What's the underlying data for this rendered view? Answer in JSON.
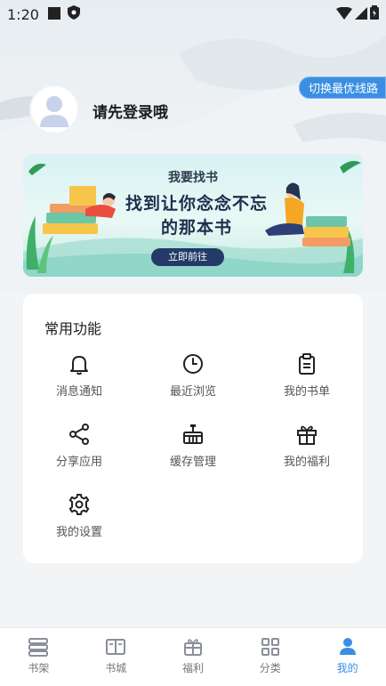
{
  "status_bar": {
    "time": "1:20"
  },
  "route_switch": {
    "label": "切换最优线路"
  },
  "profile": {
    "login_prompt": "请先登录哦"
  },
  "banner": {
    "heading": "我要找书",
    "slogan_line1": "找到让你念念不忘",
    "slogan_line2": "的那本书",
    "cta": "立即前往"
  },
  "functions": {
    "title": "常用功能",
    "items": [
      {
        "label": "消息通知",
        "icon": "bell-icon"
      },
      {
        "label": "最近浏览",
        "icon": "clock-icon"
      },
      {
        "label": "我的书单",
        "icon": "clipboard-icon"
      },
      {
        "label": "分享应用",
        "icon": "share-icon"
      },
      {
        "label": "缓存管理",
        "icon": "basket-icon"
      },
      {
        "label": "我的福利",
        "icon": "gift-icon"
      },
      {
        "label": "我的设置",
        "icon": "gear-icon"
      }
    ]
  },
  "nav": {
    "active": "我的",
    "accent_color": "#3b8fe3",
    "tabs": [
      {
        "label": "书架",
        "icon": "bookshelf-icon"
      },
      {
        "label": "书城",
        "icon": "open-book-icon"
      },
      {
        "label": "福利",
        "icon": "gift-icon"
      },
      {
        "label": "分类",
        "icon": "grid-icon"
      },
      {
        "label": "我的",
        "icon": "person-icon"
      }
    ]
  }
}
